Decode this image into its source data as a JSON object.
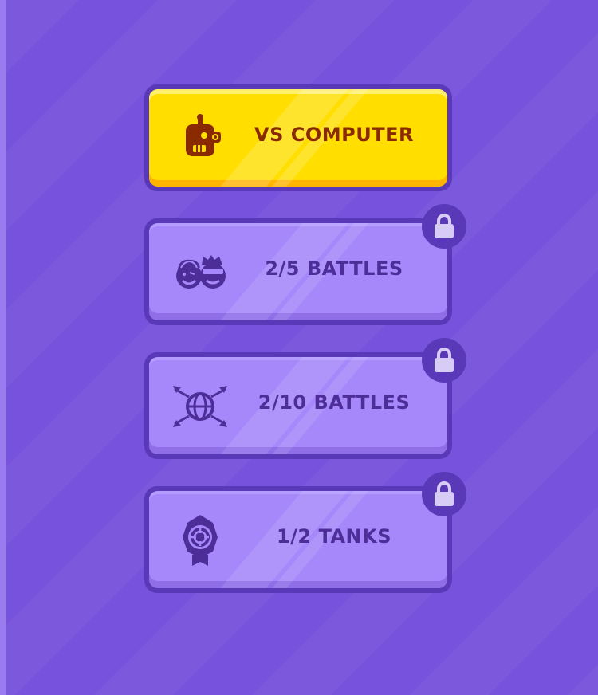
{
  "colors": {
    "background": "#7752dc",
    "primary_button": "#ffde00",
    "primary_text": "#8a2a00",
    "locked_button": "#a688fa",
    "locked_text": "#4d2e98",
    "border": "#5a39b8"
  },
  "menu": {
    "buttons": [
      {
        "label": "VS COMPUTER",
        "icon": "robot-icon",
        "locked": false
      },
      {
        "label": "2/5  BATTLES",
        "icon": "friends-icon",
        "locked": true
      },
      {
        "label": "2/10  BATTLES",
        "icon": "globe-arrows-icon",
        "locked": true
      },
      {
        "label": "1/2 TANKS",
        "icon": "target-badge-icon",
        "locked": true
      }
    ]
  }
}
